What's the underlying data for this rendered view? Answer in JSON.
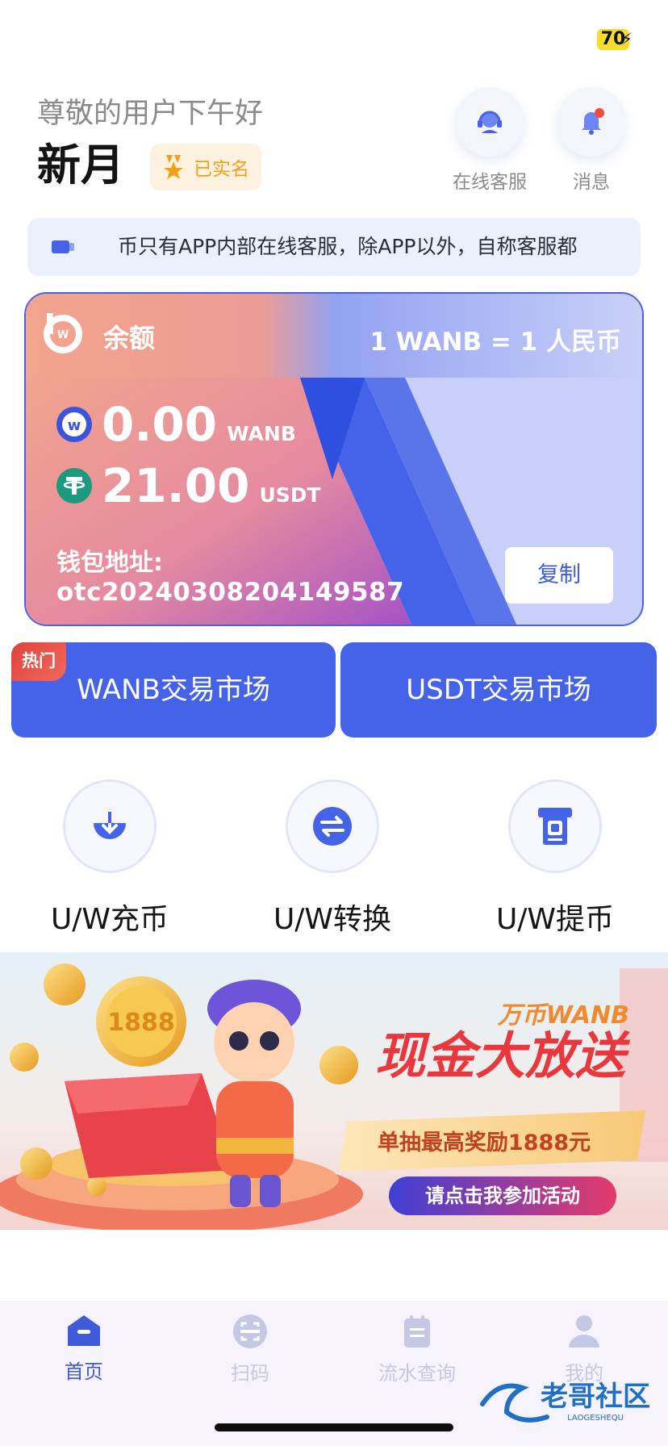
{
  "status_bar": {
    "battery": "70"
  },
  "header": {
    "greeting": "尊敬的用户下午好",
    "username": "新月",
    "verified_badge": "已实名",
    "service_label": "在线客服",
    "message_label": "消息"
  },
  "notice": {
    "text": "币只有APP内部在线客服，除APP以外，自称客服都"
  },
  "balance_card": {
    "title": "余额",
    "rate": "1 WANB = 1 人民币",
    "wanb_amount": "0.00",
    "wanb_unit": "WANB",
    "usdt_amount": "21.00",
    "usdt_unit": "USDT",
    "wallet_label": "钱包地址:",
    "wallet_address": "otc20240308204149587",
    "copy_label": "复制"
  },
  "markets": {
    "hot_badge": "热门",
    "wanb_market": "WANB交易市场",
    "usdt_market": "USDT交易市场"
  },
  "actions": [
    {
      "label": "U/W充币",
      "icon": "deposit-icon"
    },
    {
      "label": "U/W转换",
      "icon": "exchange-icon"
    },
    {
      "label": "U/W提币",
      "icon": "withdraw-icon"
    }
  ],
  "banner": {
    "brand": "万币WANB",
    "headline": "现金大放送",
    "subline": "单抽最高奖励1888元",
    "cta": "请点击我参加活动",
    "coin_text": "1888"
  },
  "tabbar": {
    "items": [
      {
        "label": "首页",
        "icon": "home-icon",
        "active": true
      },
      {
        "label": "扫码",
        "icon": "scan-icon",
        "active": false
      },
      {
        "label": "流水查询",
        "icon": "records-icon",
        "active": false
      },
      {
        "label": "我的",
        "icon": "profile-icon",
        "active": false
      }
    ]
  },
  "watermark": {
    "text": "老哥社区",
    "subtext": "LAOGESHEQU"
  },
  "colors": {
    "primary": "#4563e8",
    "accent_orange": "#f2a019",
    "hot_red": "#e0413f",
    "tab_active": "#3f5bd9",
    "tab_inactive": "#c5c8e4"
  }
}
